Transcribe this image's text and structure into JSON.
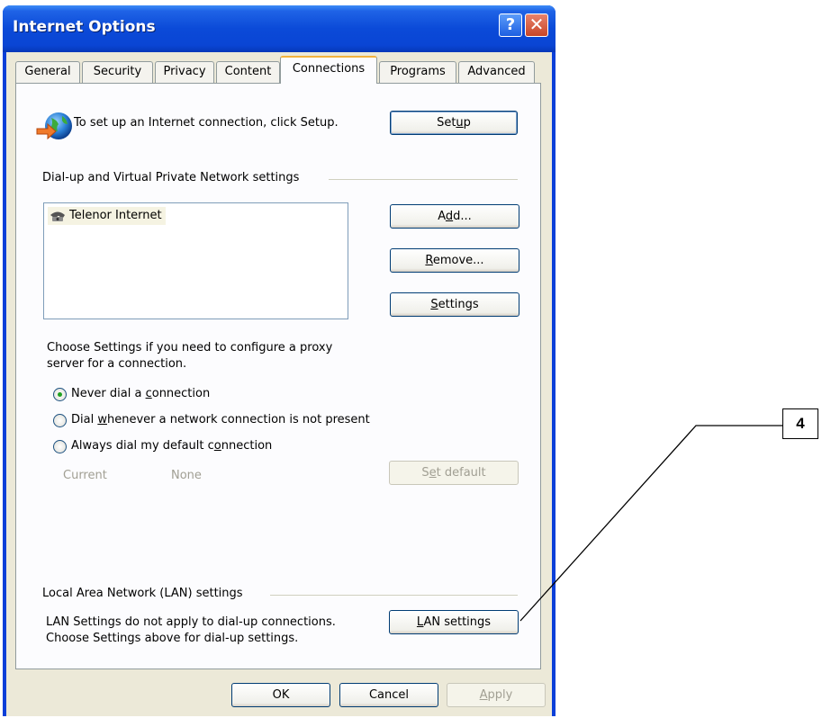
{
  "window": {
    "title": "Internet Options",
    "help_glyph": "?",
    "close_glyph": "✕"
  },
  "tabs": [
    {
      "label": "General"
    },
    {
      "label": "Security"
    },
    {
      "label": "Privacy"
    },
    {
      "label": "Content"
    },
    {
      "label": "Connections",
      "active": true
    },
    {
      "label": "Programs"
    },
    {
      "label": "Advanced"
    }
  ],
  "setup": {
    "text": "To set up an Internet connection, click Setup.",
    "button_pre": "Set",
    "button_acc": "u",
    "button_post": "p"
  },
  "dialup": {
    "group_label": "Dial-up and Virtual Private Network settings",
    "items": [
      "Telenor Internet"
    ],
    "add_pre": "A",
    "add_acc": "d",
    "add_post": "d...",
    "remove_pre": "",
    "remove_acc": "R",
    "remove_post": "emove...",
    "settings_pre": "",
    "settings_acc": "S",
    "settings_post": "ettings"
  },
  "proxy_text": "Choose Settings if you need to configure a proxy server for a connection.",
  "radios": [
    {
      "pre": "Never dial a ",
      "acc": "c",
      "post": "onnection",
      "checked": true
    },
    {
      "pre": "Dial ",
      "acc": "w",
      "post": "henever a network connection is not present",
      "checked": false
    },
    {
      "pre": "Always dial my default c",
      "acc": "o",
      "post": "nnection",
      "checked": false
    }
  ],
  "current": {
    "label": "Current",
    "value": "None",
    "setdefault_pre": "S",
    "setdefault_acc": "e",
    "setdefault_post": "t default"
  },
  "lan": {
    "group_label": "Local Area Network (LAN) settings",
    "text": "LAN Settings do not apply to dial-up connections. Choose Settings above for dial-up settings.",
    "button_pre": "",
    "button_acc": "L",
    "button_post": "AN settings"
  },
  "footer": {
    "ok": "OK",
    "cancel": "Cancel",
    "apply_pre": "",
    "apply_acc": "A",
    "apply_post": "pply"
  },
  "callout": {
    "number": "4"
  }
}
